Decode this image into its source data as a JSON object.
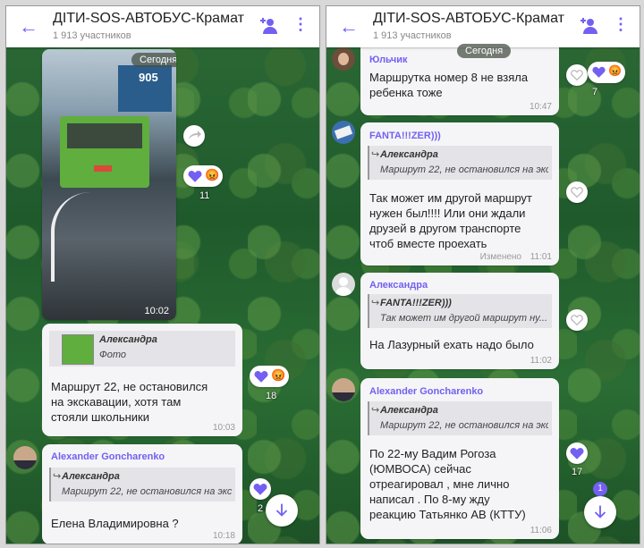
{
  "chat": {
    "title": "ДІТИ-SOS-АВТОБУС-Крамат",
    "members": "1 913 участников"
  },
  "left": {
    "date": "Сегодня",
    "photo_time": "10:02",
    "photo_sign": "905",
    "photo_react_count": "11",
    "msg1": {
      "quote_name": "Александра",
      "quote_text": "Фото",
      "text_lines": [
        "Маршрут 22, не остановился",
        "на экскавации, хотя там",
        "стояли школьники"
      ],
      "time": "10:03",
      "react_count": "18"
    },
    "msg2": {
      "sender": "Alexander Goncharenko",
      "quote_name": "Александра",
      "quote_text": "Маршрут 22, не остановился на экс...",
      "text": "Елена Владимировна ?",
      "time": "10:18",
      "react_count": "2"
    }
  },
  "right": {
    "date": "Сегодня",
    "msg1": {
      "sender": "Юльчик",
      "text_lines": [
        "Маршрутка номер 8 не взяла",
        "ребенка тоже"
      ],
      "time": "10:47",
      "react_count": "7"
    },
    "msg2": {
      "sender": "FANTA!!!ZER)))",
      "quote_name": "Александра",
      "quote_text": "Маршрут 22, не остановился на экс...",
      "text_lines": [
        "Так может им другой маршрут",
        "нужен был!!!! Или они ждали",
        "друзей в другом транспорте",
        "чтоб вместе проехать"
      ],
      "edited": "Изменено",
      "time": "11:01"
    },
    "msg3": {
      "sender": "Александра",
      "quote_name": "FANTA!!!ZER)))",
      "quote_text": "Так может им другой маршрут ну...",
      "text": "На Лазурный ехать надо было",
      "time": "11:02"
    },
    "msg4": {
      "sender": "Alexander Goncharenko",
      "quote_name": "Александра",
      "quote_text": "Маршрут 22, не остановился на экс...",
      "text_lines": [
        "По 22-му Вадим Рогоза",
        "(ЮМВОСА) сейчас",
        "отреагировал , мне лично",
        "написал . По 8-му жду",
        "реакцию Татьянко АВ (КТТУ)"
      ],
      "time": "11:06",
      "react_count": "17"
    },
    "unread_badge": "1"
  },
  "colors": {
    "accent": "#7360f2",
    "bubble": "#f5f5f7",
    "heart": "#7360f2"
  },
  "icons": [
    "back-arrow-icon",
    "add-participant-icon",
    "more-vert-icon",
    "share-icon",
    "heart-icon",
    "emoji-icon",
    "scroll-down-icon",
    "reply-icon",
    "user-avatar-icon"
  ]
}
